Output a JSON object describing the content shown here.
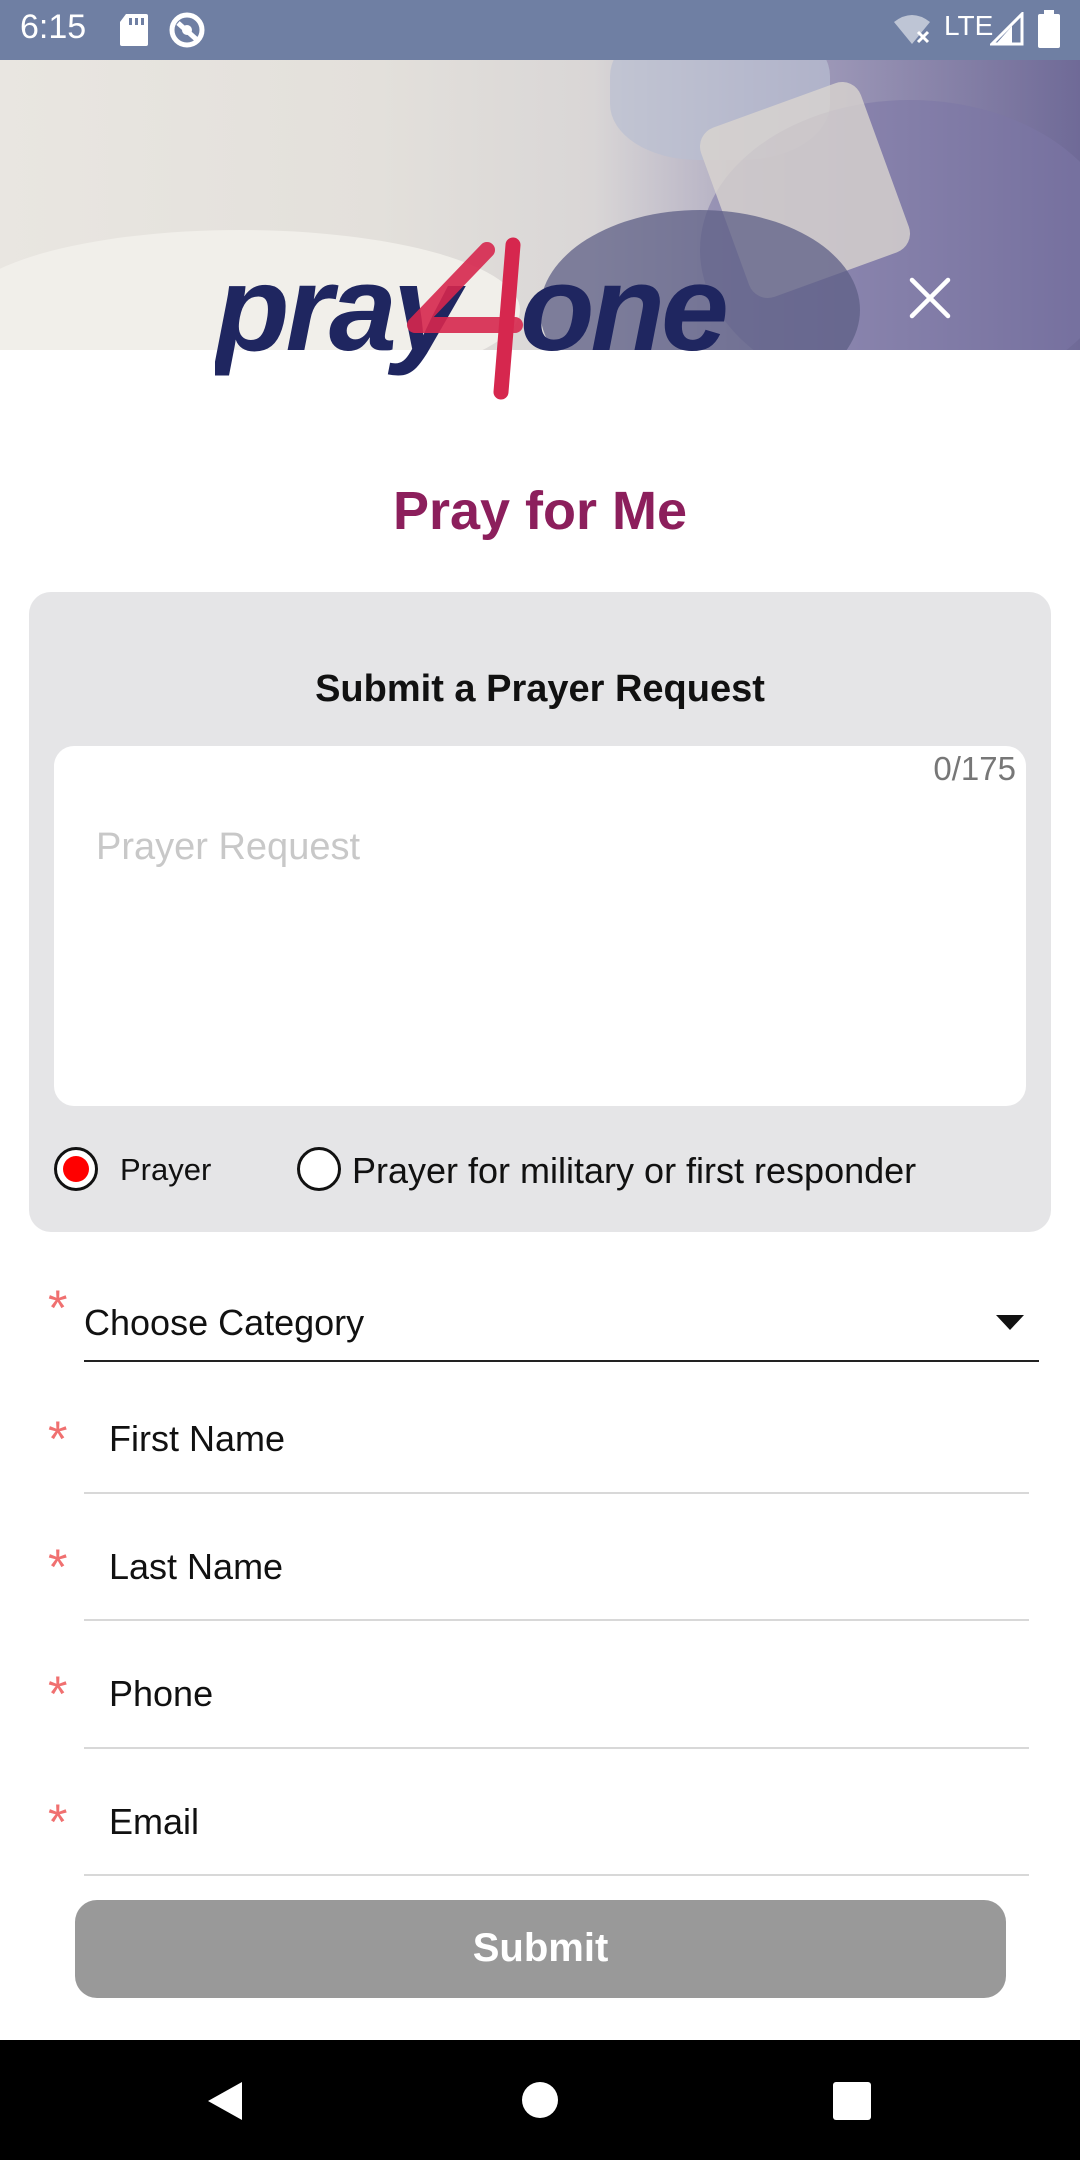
{
  "status_bar": {
    "time": "6:15",
    "network": "LTE",
    "icons": [
      "sd-card-icon",
      "sync-icon",
      "wifi-off-icon",
      "signal-icon",
      "battery-icon"
    ]
  },
  "header": {
    "logo_text": "pray4one",
    "close_icon": "close-icon"
  },
  "page": {
    "title": "Pray for Me"
  },
  "request_card": {
    "title": "Submit a Prayer Request",
    "counter": "0/175",
    "placeholder": "Prayer Request",
    "options": [
      {
        "label": "Prayer",
        "selected": true
      },
      {
        "label": "Prayer for military or first responder",
        "selected": false
      }
    ],
    "selected_color": "#ff0000"
  },
  "form": {
    "required_marker": "*",
    "category": {
      "label": "Choose Category",
      "icon": "dropdown-caret-icon"
    },
    "fields": [
      {
        "label": "First Name"
      },
      {
        "label": "Last Name"
      },
      {
        "label": "Phone"
      },
      {
        "label": "Email"
      }
    ],
    "submit_label": "Submit"
  },
  "colors": {
    "status_bar": "#6f7fa3",
    "title": "#8c1f5c",
    "logo_navy": "#1f2660",
    "logo_red": "#d6274e",
    "required": "#f07070",
    "submit_disabled": "#999999"
  },
  "nav_bar": {
    "icons": [
      "back-icon",
      "home-icon",
      "recents-icon"
    ]
  }
}
